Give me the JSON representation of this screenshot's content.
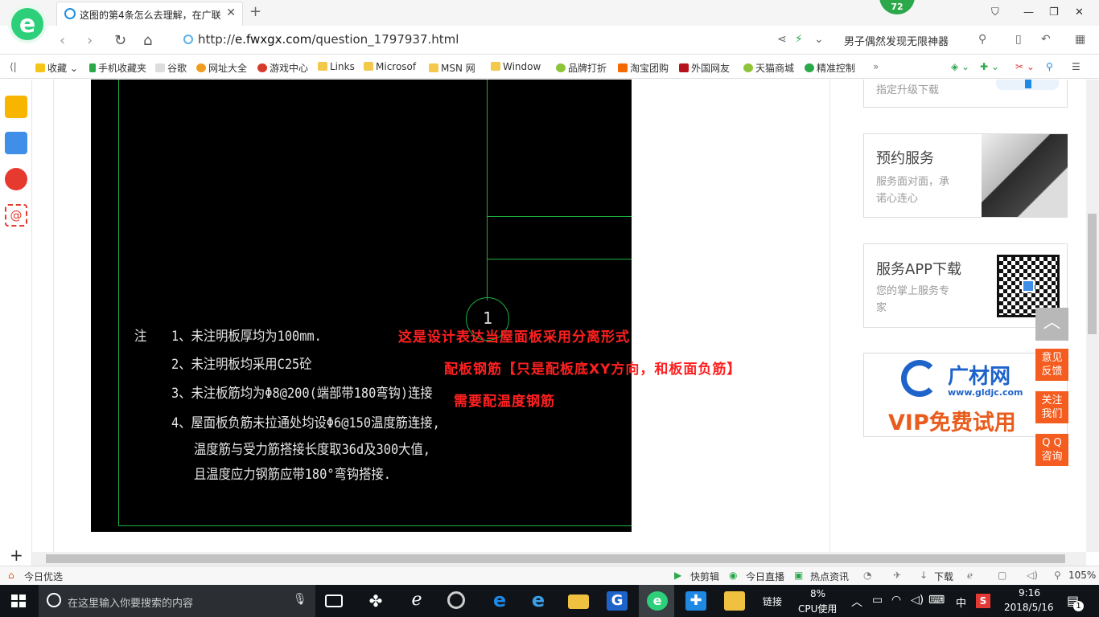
{
  "browser": {
    "tab_title": "这图的第4条怎么去理解，在广联",
    "badge_count": "72",
    "url_prefix": "http://",
    "url_domain": "e.fwxgx.com",
    "url_path": "/question_1797937.html",
    "hot_search": "男子偶然发现无限神器",
    "accent": "#2ecf7a"
  },
  "bookmarks": [
    "收藏",
    "手机收藏夹",
    "谷歌",
    "网址大全",
    "游戏中心",
    "Links",
    "Microsof",
    "MSN 网",
    "Window",
    "品牌打折",
    "淘宝团购",
    "外国网友",
    "天猫商城",
    "精准控制"
  ],
  "cad": {
    "circle_label": "1",
    "note_label": "注",
    "notes": [
      "1、未注明板厚均为100mm.",
      "2、未注明板均采用C25砼",
      "3、未注板筋均为Φ8@200(端部带180弯钩)连接",
      "4、屋面板负筋未拉通处均设Φ6@150温度筋连接,",
      "温度筋与受力筋搭接长度取36d及300大值,",
      "且温度应力钢筋应带180°弯钩搭接."
    ],
    "red_annotations": [
      "这是设计表达当屋面板采用分离形式",
      "配板钢筋【只是配板底XY方向，和板面负筋】",
      "需要配温度钢筋"
    ]
  },
  "sidebar_cards": {
    "upgrade_text": "指定升级下载",
    "booking_title": "预约服务",
    "booking_desc_1": "服务面对面，承",
    "booking_desc_2": "诺心连心",
    "app_title": "服务APP下载",
    "app_desc_1": "您的掌上服务专",
    "app_desc_2": "家",
    "ad_brand": "广材网",
    "ad_site": "www.gldjc.com",
    "ad_slogan": "VIP免费试用"
  },
  "float_buttons": [
    {
      "l1": "意见",
      "l2": "反馈"
    },
    {
      "l1": "关注",
      "l2": "我们"
    },
    {
      "l1": "Q Q",
      "l2": "咨询"
    }
  ],
  "statusbar": {
    "today": "今日优选",
    "quick_clip": "快剪辑",
    "live": "今日直播",
    "hot_news": "热点资讯",
    "download": "下载",
    "zoom": "105%"
  },
  "taskbar": {
    "search_placeholder": "在这里输入你要搜索的内容",
    "link": "链接",
    "cpu_value": "8%",
    "cpu_label": "CPU使用",
    "ime": "中",
    "time": "9:16",
    "date": "2018/5/16",
    "notif_count": "1"
  }
}
